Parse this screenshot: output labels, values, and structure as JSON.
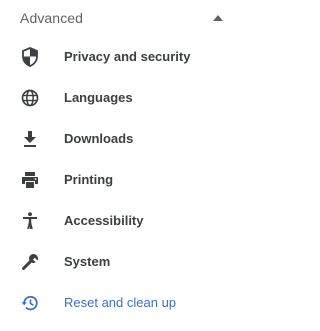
{
  "section": {
    "title": "Advanced",
    "caret_icon": "caret-up-icon",
    "expanded": true
  },
  "menu": {
    "items": [
      {
        "label": "Privacy and security",
        "icon": "shield-icon",
        "selected": false
      },
      {
        "label": "Languages",
        "icon": "globe-icon",
        "selected": false
      },
      {
        "label": "Downloads",
        "icon": "download-icon",
        "selected": false
      },
      {
        "label": "Printing",
        "icon": "printer-icon",
        "selected": false
      },
      {
        "label": "Accessibility",
        "icon": "accessibility-icon",
        "selected": false
      },
      {
        "label": "System",
        "icon": "wrench-icon",
        "selected": false
      },
      {
        "label": "Reset and clean up",
        "icon": "restore-icon",
        "selected": true
      }
    ]
  },
  "colors": {
    "text": "#3c4043",
    "header_text": "#5f6368",
    "icon": "#3c4043",
    "selected": "#3f6fc0",
    "background": "#ffffff"
  }
}
